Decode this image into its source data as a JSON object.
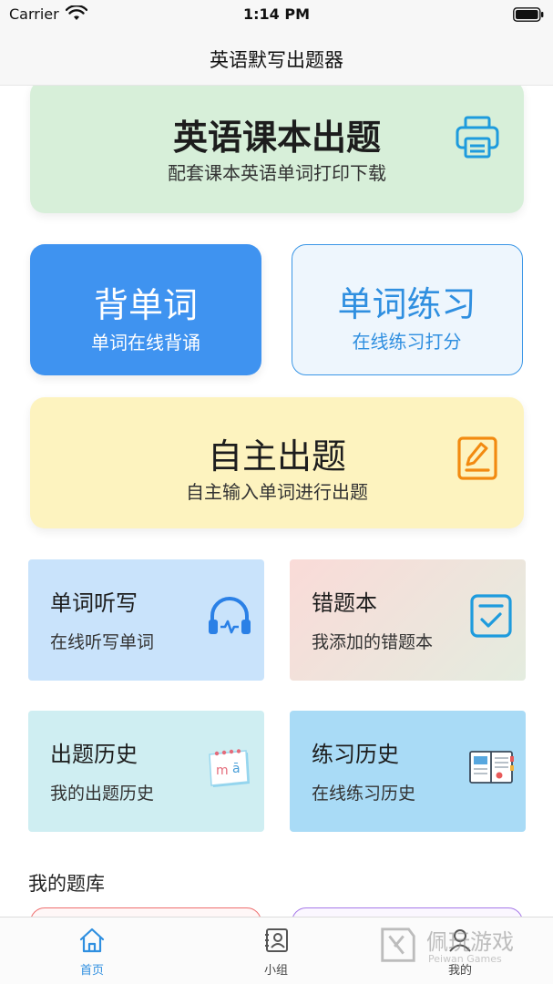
{
  "status_bar": {
    "carrier": "Carrier",
    "time": "1:14 PM",
    "icons": [
      "wifi-icon",
      "battery-icon"
    ]
  },
  "nav": {
    "title": "英语默写出题器"
  },
  "cards": {
    "textbook": {
      "title": "英语课本出题",
      "subtitle": "配套课本英语单词打印下载",
      "icon": "printer-icon",
      "color": "#d7efd9"
    },
    "memorize": {
      "title": "背单词",
      "subtitle": "单词在线背诵",
      "color": "#3f93f0"
    },
    "practice": {
      "title": "单词练习",
      "subtitle": "在线练习打分",
      "color": "#2f8fe0"
    },
    "custom": {
      "title": "自主出题",
      "subtitle": "自主输入单词进行出题",
      "icon": "edit-icon",
      "color": "#fdf3bf"
    }
  },
  "tiles": {
    "dictation": {
      "title": "单词听写",
      "subtitle": "在线听写单词",
      "icon": "headphones-icon"
    },
    "mistakes": {
      "title": "错题本",
      "subtitle": "我添加的错题本",
      "icon": "checklist-icon"
    },
    "question_history": {
      "title": "出题历史",
      "subtitle": "我的出题历史",
      "icon": "calendar-icon"
    },
    "practice_history": {
      "title": "练习历史",
      "subtitle": "在线练习历史",
      "icon": "notebook-icon"
    }
  },
  "section": {
    "my_bank": "我的题库"
  },
  "tab_bar": {
    "home": "首页",
    "group": "小组",
    "mine": "我的",
    "active_color": "#2f8fe0"
  },
  "watermark": {
    "text": "佩玩游戏",
    "sub": "Peiwan Games"
  }
}
